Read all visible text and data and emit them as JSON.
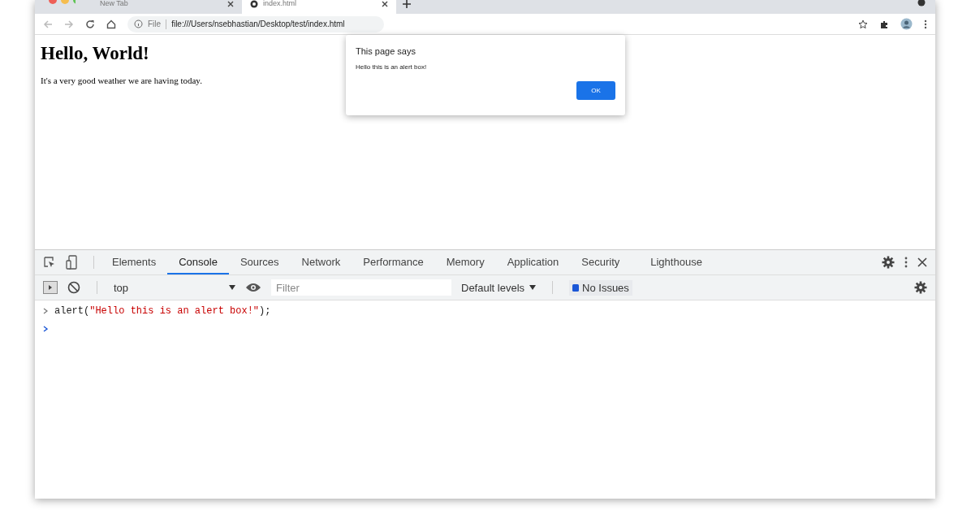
{
  "browser": {
    "tabs": [
      {
        "title": "New Tab",
        "selected": false
      },
      {
        "title": "index.html",
        "selected": true
      }
    ],
    "address": {
      "scheme": "File",
      "url": "file:///Users/nsebhastian/Desktop/test/index.html"
    }
  },
  "page": {
    "heading": "Hello, World!",
    "paragraph": "It's a very good weather we are having today."
  },
  "alert": {
    "title": "This page says",
    "message": "Hello this is an alert box!",
    "button": "OK"
  },
  "devtools": {
    "tabs": [
      {
        "label": "Elements",
        "selected": false
      },
      {
        "label": "Console",
        "selected": true
      },
      {
        "label": "Sources",
        "selected": false
      },
      {
        "label": "Network",
        "selected": false
      },
      {
        "label": "Performance",
        "selected": false
      },
      {
        "label": "Memory",
        "selected": false
      },
      {
        "label": "Application",
        "selected": false
      },
      {
        "label": "Security",
        "selected": false
      },
      {
        "label": "Lighthouse",
        "selected": false
      }
    ],
    "context": "top",
    "filter": {
      "placeholder": "Filter"
    },
    "levels": "Default levels",
    "issues": "No Issues",
    "console": [
      {
        "kind": "command",
        "parts": [
          {
            "kind": "code",
            "text": "alert("
          },
          {
            "kind": "string",
            "text": "\"Hello this is an alert box!\""
          },
          {
            "kind": "code",
            "text": ");"
          }
        ]
      },
      {
        "kind": "prompt"
      }
    ]
  }
}
